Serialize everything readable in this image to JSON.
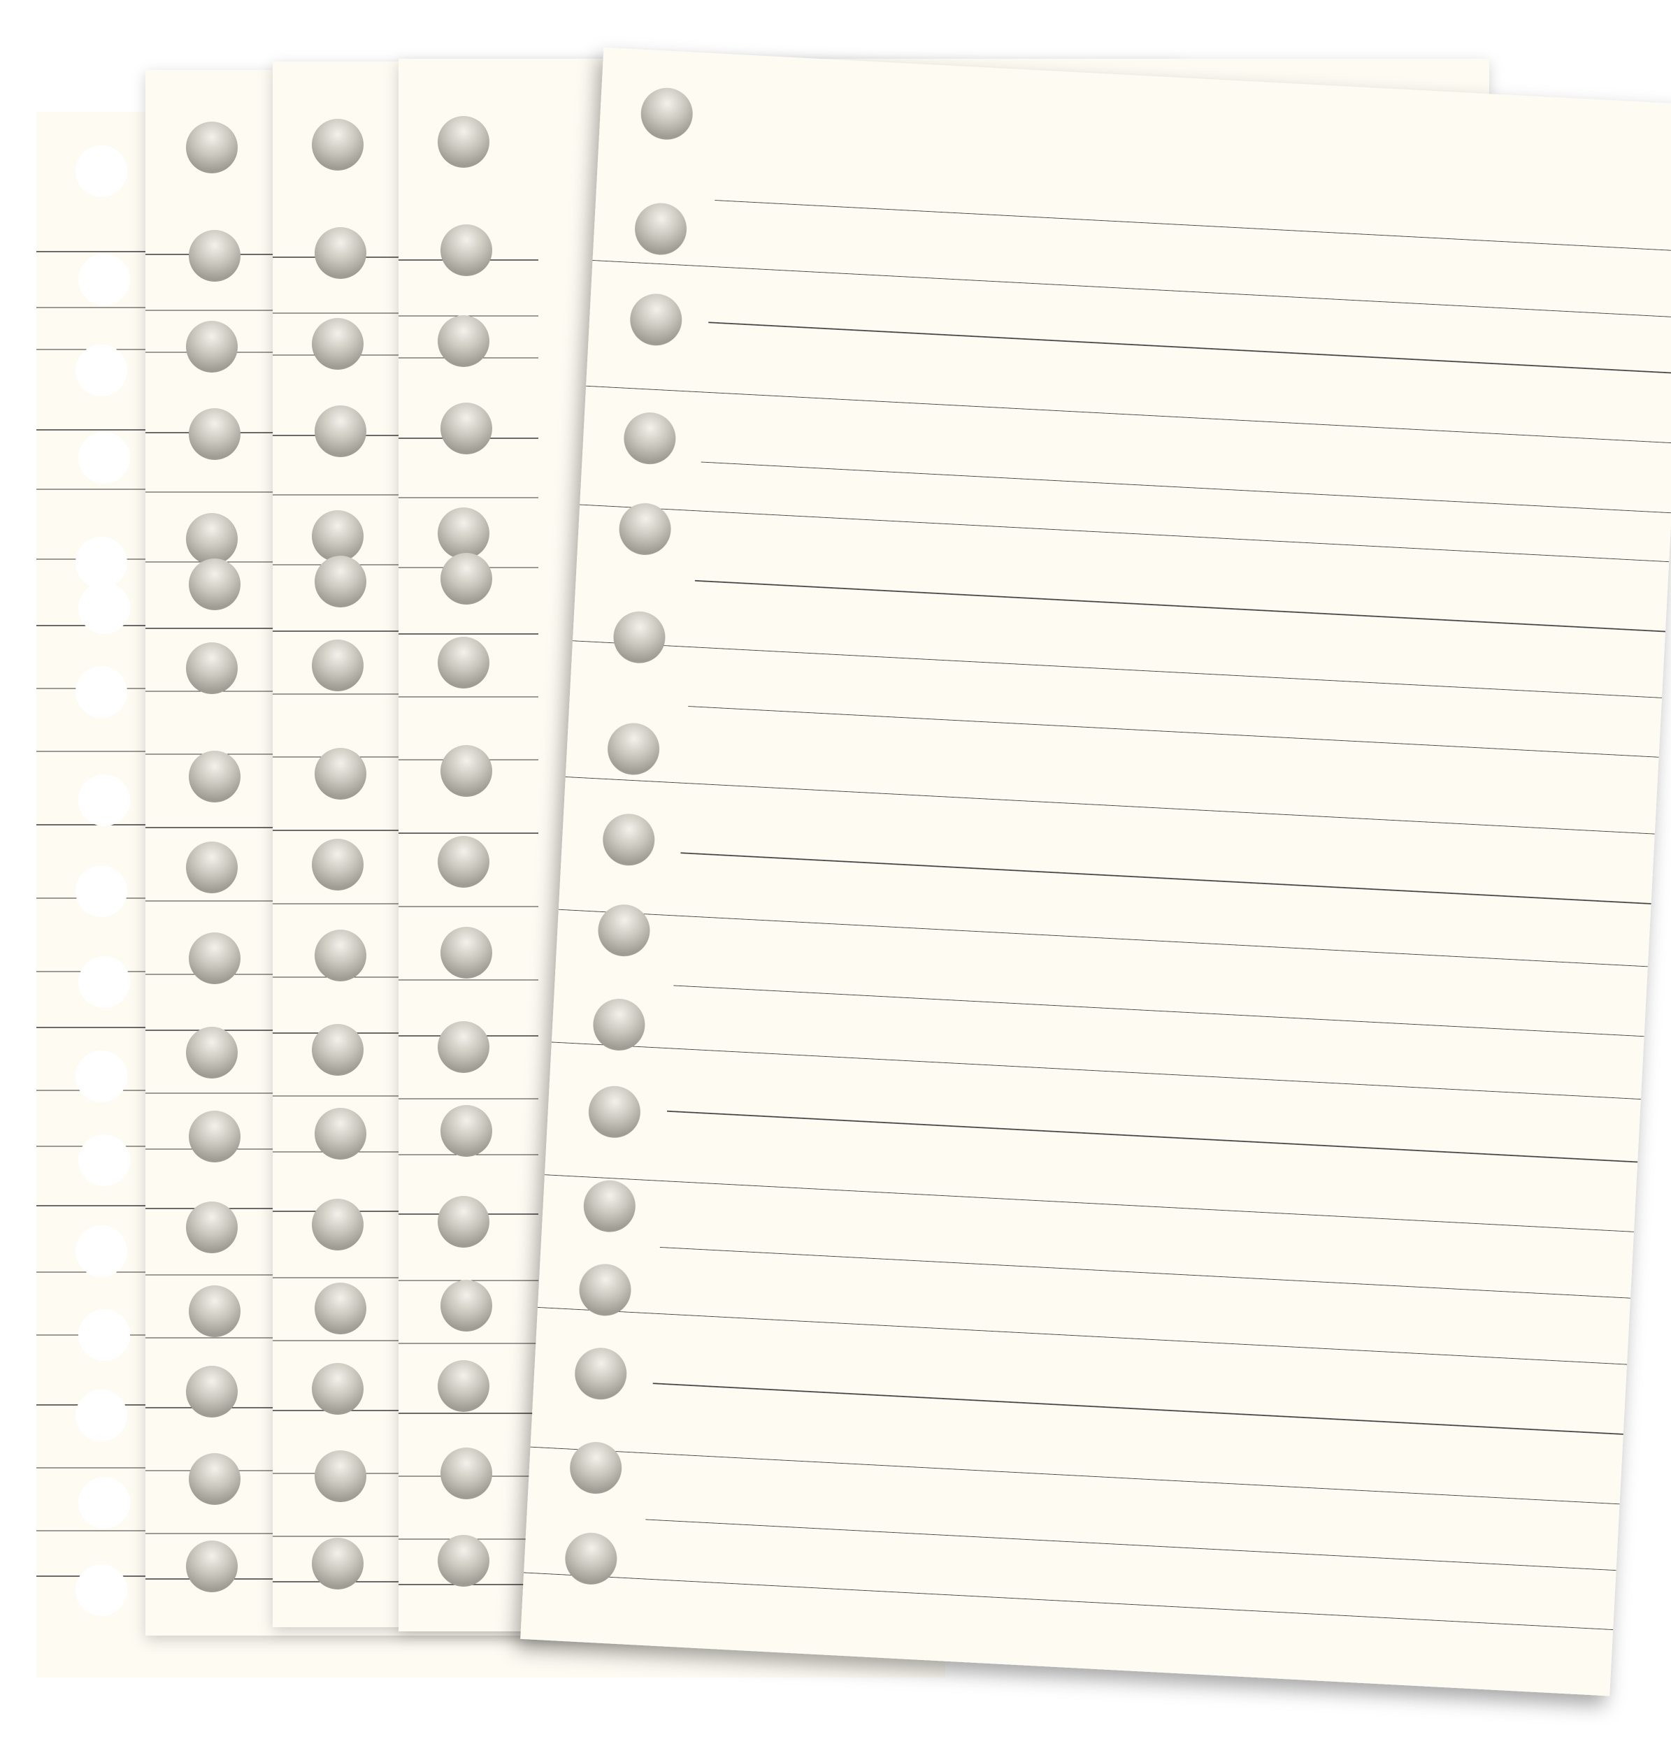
{
  "scene": {
    "description_visible_text": "",
    "background_color": "#ffffff",
    "paper_color": "#fdfbf2",
    "hole_color": "#b9b6ae",
    "line_color": "#3a3a3a",
    "sheet_count": 5,
    "front_sheet_rotation_deg": 3
  }
}
